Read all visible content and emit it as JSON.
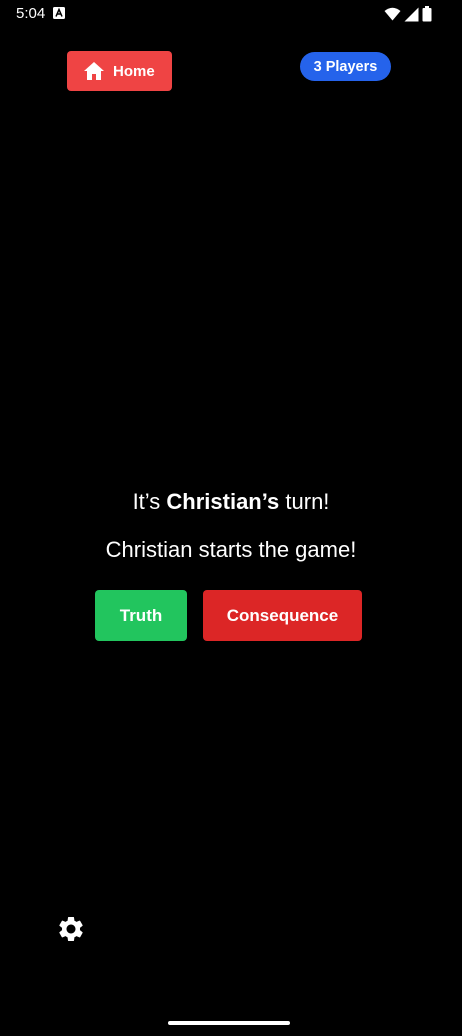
{
  "status_bar": {
    "time": "5:04",
    "icons": [
      "app-notification-icon",
      "wifi-icon",
      "cell-signal-icon",
      "battery-icon"
    ]
  },
  "header": {
    "home_label": "Home",
    "home_icon": "home-icon",
    "players_label": "3 Players"
  },
  "game": {
    "turn_prefix": "It’s ",
    "turn_player": "Christian’s",
    "turn_suffix": " turn!",
    "start_message": "Christian starts the game!"
  },
  "actions": {
    "truth_label": "Truth",
    "consequence_label": "Consequence"
  },
  "footer": {
    "settings_icon": "gear-icon"
  },
  "colors": {
    "background": "#000000",
    "home_button": "#ef4444",
    "players_badge": "#2563eb",
    "truth_button": "#22c55e",
    "consequence_button": "#dc2626",
    "text": "#ffffff"
  }
}
